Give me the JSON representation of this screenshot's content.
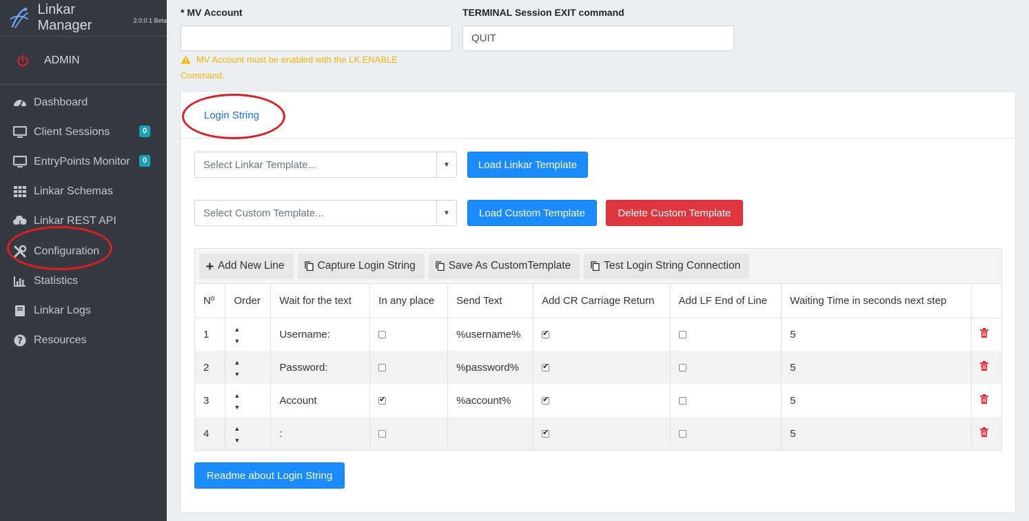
{
  "sidebar": {
    "brand_title": "Linkar Manager",
    "brand_version": "2.0.0.1 Beta",
    "user": "ADMIN",
    "items": [
      {
        "label": "Dashboard",
        "icon": "dashboard-icon"
      },
      {
        "label": "Client Sessions",
        "icon": "monitor-icon",
        "badge": "0"
      },
      {
        "label": "EntryPoints Monitor",
        "icon": "monitor-icon",
        "badge": "0"
      },
      {
        "label": "Linkar Schemas",
        "icon": "grid-icon"
      },
      {
        "label": "Linkar REST API",
        "icon": "cloud-icon"
      },
      {
        "label": "Configuration",
        "icon": "tools-icon"
      },
      {
        "label": "Statistics",
        "icon": "bar-chart-icon"
      },
      {
        "label": "Linkar Logs",
        "icon": "book-icon"
      },
      {
        "label": "Resources",
        "icon": "question-icon"
      }
    ]
  },
  "form": {
    "mv_account_label": "* MV Account",
    "mv_account_value": "",
    "mv_warning": "MV Account must be enabled with the LK.ENABLE Command.",
    "terminal_exit_label": "TERMINAL Session EXIT command",
    "terminal_exit_value": "QUIT"
  },
  "login_card": {
    "tab": "Login String",
    "linkar_template_placeholder": "Select Linkar Template...",
    "load_linkar_template": "Load Linkar Template",
    "custom_template_placeholder": "Select Custom Template...",
    "load_custom_template": "Load Custom Template",
    "delete_custom_template": "Delete Custom Template",
    "toolbar": {
      "add_new_line": "Add New Line",
      "capture_login_string": "Capture Login String",
      "save_as_custom": "Save As CustomTemplate",
      "test_connection": "Test Login String Connection"
    },
    "columns": [
      "Nº",
      "Order",
      "Wait for the text",
      "In any place",
      "Send Text",
      "Add CR Carriage Return",
      "Add LF End of Line",
      "Waiting Time in seconds next step",
      ""
    ],
    "rows": [
      {
        "n": "1",
        "wait": "Username:",
        "any_place": false,
        "send": "%username%",
        "cr": true,
        "lf": false,
        "time": "5"
      },
      {
        "n": "2",
        "wait": "Password:",
        "any_place": false,
        "send": "%password%",
        "cr": true,
        "lf": false,
        "time": "5"
      },
      {
        "n": "3",
        "wait": "Account",
        "any_place": true,
        "send": "%account%",
        "cr": true,
        "lf": false,
        "time": "5"
      },
      {
        "n": "4",
        "wait": ":",
        "any_place": false,
        "send": "",
        "cr": true,
        "lf": false,
        "time": "5"
      }
    ],
    "order_glyphs": "▲ ▼",
    "readme_button": "Readme about Login String"
  },
  "colors": {
    "sidebar_bg": "#343a40",
    "primary": "#1a8cff",
    "danger": "#e0363f",
    "warning": "#f4b400",
    "annotation": "#e41b23"
  }
}
